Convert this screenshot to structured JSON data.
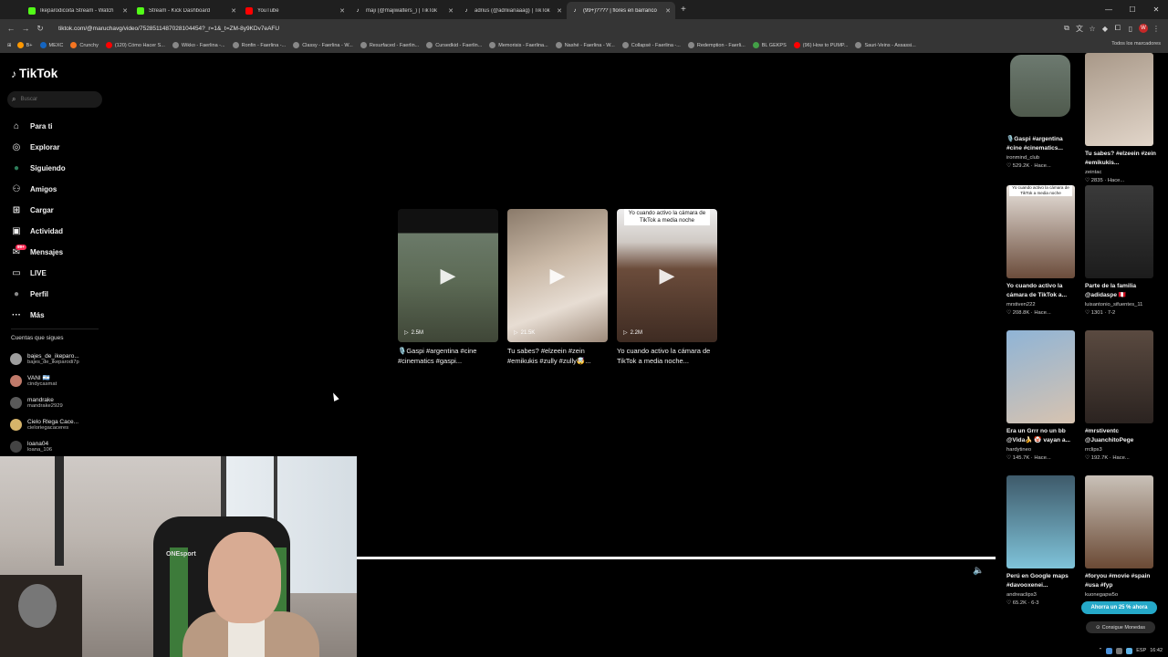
{
  "browser": {
    "tabs": [
      {
        "title": "Ikeparodicoita Stream - Watch",
        "icon_color": "#53fc18"
      },
      {
        "title": "Stream - Kick Dashboard",
        "icon_color": "#53fc18"
      },
      {
        "title": "YouTube",
        "icon_color": "#ff0000"
      },
      {
        "title": "maji (@majiwalters_) | TikTok",
        "icon_color": "#ffffff"
      },
      {
        "title": "adrius (@adriiianaaag) | TikTok",
        "icon_color": "#ffffff"
      },
      {
        "title": "(99+)???? | flores en barranco",
        "icon_color": "#ffffff"
      }
    ],
    "active_tab": 5,
    "new_tab": "+",
    "url": "tiktok.com/@maruchavg/video/7528511487028104454?_r=1&_t=ZM-8y9KDv7eAFU",
    "bookmarks": [
      {
        "label": "B+",
        "color": "#ff9800"
      },
      {
        "label": "MEXC",
        "color": "#1565c0"
      },
      {
        "label": "Crunchy",
        "color": "#f47521"
      },
      {
        "label": "(120) Cómo Hacer S...",
        "color": "#ff0000"
      },
      {
        "label": "Wikko - Faerlina -...",
        "color": "#888888"
      },
      {
        "label": "Ronfin - Faerlina -...",
        "color": "#888888"
      },
      {
        "label": "Classy - Faerlina - W...",
        "color": "#888888"
      },
      {
        "label": "Resurfaced - Faerlin...",
        "color": "#888888"
      },
      {
        "label": "Cursedkid - Faerlin...",
        "color": "#888888"
      },
      {
        "label": "Memorisis - Faerlina...",
        "color": "#888888"
      },
      {
        "label": "Nashé - Faerlina - W...",
        "color": "#888888"
      },
      {
        "label": "Collapsé - Faerlina -...",
        "color": "#888888"
      },
      {
        "label": "Redemption - Faerli...",
        "color": "#888888"
      },
      {
        "label": "BL GEKPS",
        "color": "#43a047"
      },
      {
        "label": "(96) How to PUMP...",
        "color": "#ff0000"
      },
      {
        "label": "Sauri-Veins - Assassi...",
        "color": "#888888"
      }
    ],
    "all_bookmarks": "Todos los marcadores"
  },
  "sidebar": {
    "brand": "TikTok",
    "search_placeholder": "Buscar",
    "nav": [
      {
        "label": "Para ti",
        "icon": "home-icon",
        "glyph": "⌂"
      },
      {
        "label": "Explorar",
        "icon": "compass-icon",
        "glyph": "◎"
      },
      {
        "label": "Siguiendo",
        "icon": "following-icon",
        "glyph": "●"
      },
      {
        "label": "Amigos",
        "icon": "friends-icon",
        "glyph": "⚇"
      },
      {
        "label": "Cargar",
        "icon": "upload-icon",
        "glyph": "⊞"
      },
      {
        "label": "Actividad",
        "icon": "activity-icon",
        "glyph": "▣"
      },
      {
        "label": "Mensajes",
        "icon": "messages-icon",
        "glyph": "✉"
      },
      {
        "label": "LIVE",
        "icon": "live-icon",
        "glyph": "▭"
      },
      {
        "label": "Perfil",
        "icon": "profile-icon",
        "glyph": "●"
      },
      {
        "label": "Más",
        "icon": "more-icon",
        "glyph": "···"
      }
    ],
    "messages_badge": "99+",
    "following_title": "Cuentas que sigues",
    "following": [
      {
        "name": "bajes_de_ikeparo...",
        "user": "bajes_de_ikeparodi7p",
        "color": "#9e9e9e"
      },
      {
        "name": "VANI 🇦🇷",
        "user": "cindycasmat",
        "color": "#c07a6a"
      },
      {
        "name": "mandrake",
        "user": "mandrake2929",
        "color": "#5a5a5a"
      },
      {
        "name": "Cielo Rlega Cace...",
        "user": "cieloriegacaceres",
        "color": "#d6b46a"
      },
      {
        "name": "loana04",
        "user": "loana_106",
        "color": "#444444"
      }
    ]
  },
  "webcam": {
    "chair_brand": "ONEsport"
  },
  "videos": [
    {
      "views": "2.5M",
      "desc": "🎙️Gaspi #argentina #cine #cinematics #gaspi...",
      "bg": "linear-gradient(180deg,#111 0%,#111 18%,#6b7a69 18%,#5c6a55 55%,#3f4637 100%)",
      "caption": ""
    },
    {
      "views": "21.5K",
      "desc": "Tu sabes? #elzeein #zein #emikukis #zully #zully🤯...",
      "bg": "linear-gradient(160deg,#8a7a6a 0%,#c9b8a6 40%,#e7ddd3 70%,#9d8a7a 100%)",
      "caption": ""
    },
    {
      "views": "2.2M",
      "desc": "Yo cuando activo la cámara de TikTok a media noche...",
      "bg": "linear-gradient(180deg,#eee 0%,#cfc9c4 25%,#6b4c3b 45%,#3e2b22 100%)",
      "caption": "Yo cuando activo la cámara de TikTok a media noche"
    }
  ],
  "recommended": [
    {
      "desc": "🎙️Gaspi #argentina #cine #cinematics...",
      "user": "ironmind_club",
      "stats": "♡ 529.2K · Hace...",
      "bg": "linear-gradient(180deg,#6d7a70,#4f5a4d)",
      "caption": ""
    },
    {
      "desc": "Tu sabes? #elzeein #zein #emikukis...",
      "user": "zeintac",
      "stats": "♡ 2835 · Hace...",
      "bg": "linear-gradient(160deg,#a89888,#e2d6ca)",
      "caption": ""
    },
    {
      "desc": "Yo cuando activo la cámara de TikTok a...",
      "user": "mrstiven222",
      "stats": "♡ 208.8K · Hace...",
      "bg": "linear-gradient(180deg,#e8e2dc,#6b4c3b)",
      "caption": "Yo cuando activo la cámara de TikTok a media noche"
    },
    {
      "desc": "Parte de la familia @adidaspe 🇵🇪",
      "user": "luisantonio_sifuentes_11",
      "stats": "♡ 1301 · 7-2",
      "bg": "linear-gradient(180deg,#3a3a3a,#1c1c1c)",
      "caption": ""
    },
    {
      "desc": "Era un Grrr no un bb @Vida🍌 🤡 vayan a...",
      "user": "hardytineo",
      "stats": "♡ 145.7K · Hace...",
      "bg": "linear-gradient(160deg,#8fb4d6,#d7c3b0)",
      "caption": ""
    },
    {
      "desc": "#mrstiventc @JuanchitoPege",
      "user": "rrclips3",
      "stats": "♡ 192.7K · Hace...",
      "bg": "linear-gradient(180deg,#5a4a40,#2b2320)",
      "caption": ""
    },
    {
      "desc": "Perú en Google maps #davooxenei...",
      "user": "andreaclips3",
      "stats": "♡ 65.2K · 6-3",
      "bg": "linear-gradient(180deg,#3e5a6a,#7fc3d9)",
      "caption": ""
    },
    {
      "desc": "#foryou #movie #spain #usa #fyp",
      "user": "kuonegapw5o",
      "stats": "",
      "bg": "linear-gradient(180deg,#c9c1b8,#6b4a35)",
      "caption": ""
    }
  ],
  "promo": "Ahorra un 25 % ahora",
  "coins": "Consigue Monedas",
  "tray": {
    "lang": "ESP",
    "time": "16:42"
  }
}
